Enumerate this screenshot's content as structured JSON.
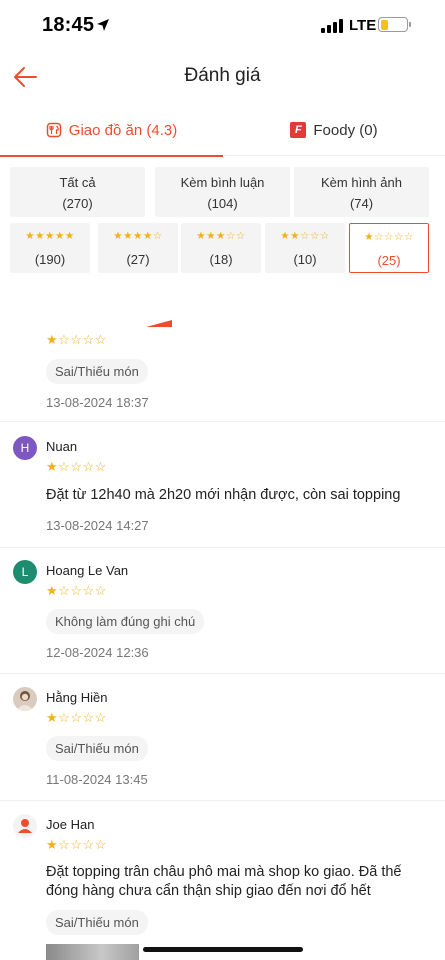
{
  "status_bar": {
    "time": "18:45",
    "network": "LTE"
  },
  "header": {
    "title": "Đánh giá"
  },
  "tabs": [
    {
      "label": "Giao đồ ăn (4.3)"
    },
    {
      "label": "Foody (0)",
      "badge": "F"
    }
  ],
  "filters": {
    "main": [
      {
        "label": "Tất cả",
        "count": "(270)"
      },
      {
        "label": "Kèm bình luận",
        "count": "(104)"
      },
      {
        "label": "Kèm hình ảnh",
        "count": "(74)"
      }
    ],
    "stars": [
      {
        "stars": 5,
        "count": "(190)"
      },
      {
        "stars": 4,
        "count": "(27)"
      },
      {
        "stars": 3,
        "count": "(18)"
      },
      {
        "stars": 2,
        "count": "(10)"
      },
      {
        "stars": 1,
        "count": "(25)",
        "selected": true
      }
    ]
  },
  "reviews": [
    {
      "name": "",
      "rating": 1,
      "tag": "Sai/Thiếu món",
      "date": "13-08-2024 18:37"
    },
    {
      "name": "Nuan",
      "avatar_letter": "H",
      "avatar_color": "#7e57c2",
      "rating": 1,
      "text": "Đặt từ 12h40 mà 2h20 mới nhận được, còn sai topping",
      "date": "13-08-2024 14:27"
    },
    {
      "name": "Hoang Le Van",
      "avatar_letter": "L",
      "avatar_color": "#1e8c6e",
      "rating": 1,
      "tag": "Không làm đúng ghi chú",
      "date": "12-08-2024 12:36"
    },
    {
      "name": "Hằng Hiền",
      "avatar_color": "#c9b8a8",
      "rating": 1,
      "tag": "Sai/Thiếu món",
      "date": "11-08-2024 13:45"
    },
    {
      "name": "Joe Han",
      "avatar_icon": "user-silhouette-icon",
      "avatar_color": "#ee4d2d",
      "rating": 1,
      "text": "Đặt topping trân châu phô mai mà shop ko giao. Đã thế đóng hàng chưa cẩn thận ship giao đến nơi đổ hết",
      "tag": "Sai/Thiếu món"
    }
  ],
  "colors": {
    "accent": "#ee4d2d",
    "star": "#f2b01e"
  }
}
